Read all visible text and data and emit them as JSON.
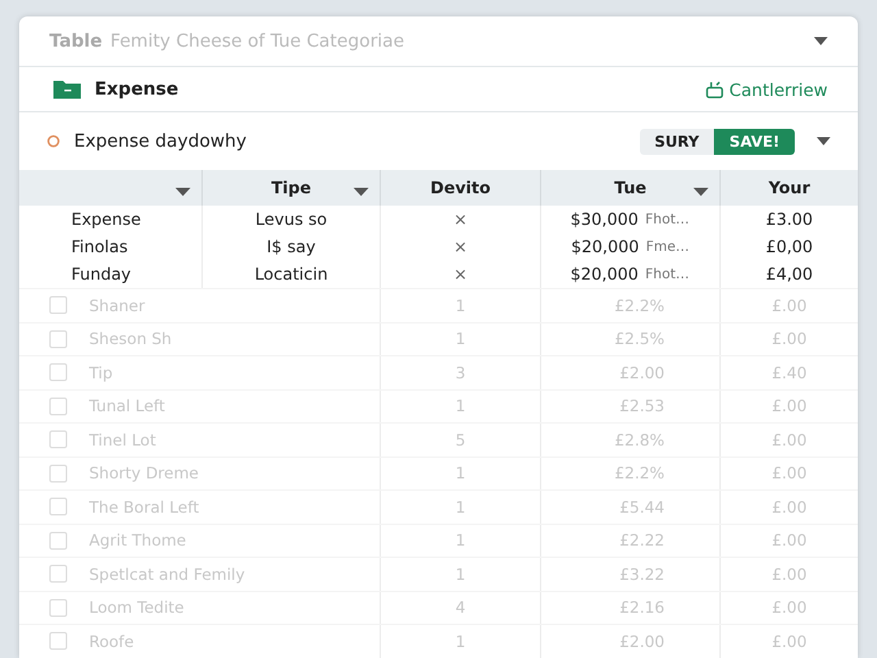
{
  "title_bar": {
    "label": "Table",
    "subtitle": "Femity Cheese of Tue Categoriae"
  },
  "section": {
    "title": "Expense",
    "link": "Cantlerriew"
  },
  "toolbar": {
    "title": "Expense daydowhy",
    "buttons": [
      {
        "label": "SURY",
        "selected": false
      },
      {
        "label": "SAVE!",
        "selected": true
      }
    ]
  },
  "table": {
    "columns": [
      {
        "sortable": true
      },
      {
        "label": "Tipe",
        "sortable": true
      },
      {
        "label": "Devito",
        "sortable": false
      },
      {
        "label": "Tue",
        "sortable": true
      },
      {
        "label": "Your",
        "sortable": false
      }
    ],
    "rows": [
      {
        "kind": "detail",
        "name": "Expense",
        "type": "Levus so",
        "devito": "×",
        "amount": "$30,000",
        "note": "Fhot…",
        "your": "£3.00"
      },
      {
        "kind": "detail",
        "name": "Finolas",
        "type": "I$ say",
        "devito": "×",
        "amount": "$20,000",
        "note": "Fme…",
        "your": "£0,00"
      },
      {
        "kind": "detail",
        "name": "Funday",
        "type": "Locaticin",
        "devito": "×",
        "amount": "$20,000",
        "note": "Fhot…",
        "your": "£4,00"
      },
      {
        "kind": "faded",
        "checked": false,
        "name": "Shaner",
        "devito": "1",
        "amount": "£2.2%",
        "your": "£.00"
      },
      {
        "kind": "faded",
        "checked": false,
        "name": "Sheson Sh",
        "devito": "1",
        "amount": "£2.5%",
        "your": "£.00"
      },
      {
        "kind": "faded",
        "checked": false,
        "name": "Tip",
        "devito": "3",
        "amount": "£2.00",
        "your": "£.40"
      },
      {
        "kind": "faded",
        "checked": false,
        "name": "Tunal Left",
        "devito": "1",
        "amount": "£2.53",
        "your": "£.00"
      },
      {
        "kind": "faded",
        "checked": false,
        "name": "Tinel Lot",
        "devito": "5",
        "amount": "£2.8%",
        "your": "£.00"
      },
      {
        "kind": "faded",
        "checked": false,
        "name": "Shorty Dreme",
        "devito": "1",
        "amount": "£2.2%",
        "your": "£.00"
      },
      {
        "kind": "faded",
        "checked": false,
        "name": "The Boral Left",
        "devito": "1",
        "amount": "£5.44",
        "your": "£.00"
      },
      {
        "kind": "faded",
        "checked": false,
        "name": "Agrit Thome",
        "devito": "1",
        "amount": "£2.22",
        "your": "£.00"
      },
      {
        "kind": "faded",
        "checked": false,
        "name": "Spetlcat and Femily",
        "devito": "1",
        "amount": "£3.22",
        "your": "£.00"
      },
      {
        "kind": "faded",
        "checked": false,
        "name": "Loom Tedite",
        "devito": "4",
        "amount": "£2.16",
        "your": "£.00"
      },
      {
        "kind": "faded",
        "checked": false,
        "name": "Roofe",
        "devito": "1",
        "amount": "£2.00",
        "your": "£.00"
      }
    ]
  }
}
